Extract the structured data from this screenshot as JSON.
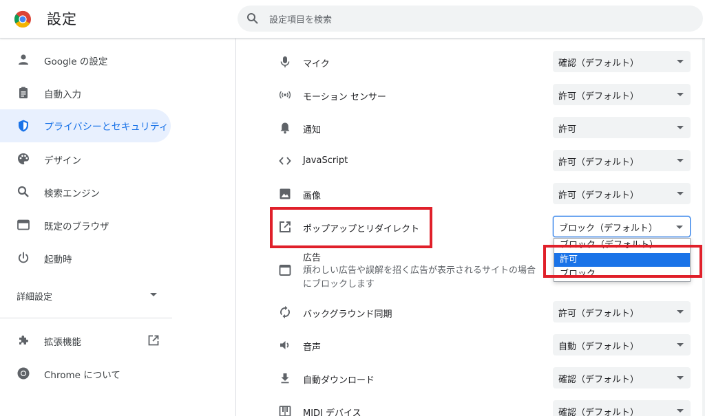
{
  "header": {
    "title": "設定",
    "search_placeholder": "設定項目を検索"
  },
  "sidebar": {
    "items": [
      {
        "label": "Google の設定",
        "icon": "person-icon"
      },
      {
        "label": "自動入力",
        "icon": "clipboard-icon"
      },
      {
        "label": "プライバシーとセキュリティ",
        "icon": "shield-icon",
        "active": true
      },
      {
        "label": "デザイン",
        "icon": "palette-icon"
      },
      {
        "label": "検索エンジン",
        "icon": "search-icon"
      },
      {
        "label": "既定のブラウザ",
        "icon": "browser-icon"
      },
      {
        "label": "起動時",
        "icon": "power-icon"
      }
    ],
    "advanced_label": "詳細設定",
    "extensions_label": "拡張機能",
    "about_label": "Chrome について"
  },
  "permissions": [
    {
      "label": "マイク",
      "value": "確認（デフォルト）",
      "icon": "mic-icon"
    },
    {
      "label": "モーション センサー",
      "value": "許可（デフォルト）",
      "icon": "motion-sensor-icon"
    },
    {
      "label": "通知",
      "value": "許可",
      "icon": "bell-icon"
    },
    {
      "label": "JavaScript",
      "value": "許可（デフォルト）",
      "icon": "code-icon"
    },
    {
      "label": "画像",
      "value": "許可（デフォルト）",
      "icon": "image-icon"
    },
    {
      "label": "ポップアップとリダイレクト",
      "value": "ブロック（デフォルト）",
      "icon": "open-in-new-icon"
    }
  ],
  "ads": {
    "title": "広告",
    "description": "煩わしい広告や誤解を招く広告が表示されるサイトの場合にブロックします"
  },
  "dropdown": {
    "options": [
      "ブロック（デフォルト）",
      "許可",
      "ブロック"
    ],
    "selected_index": 1
  },
  "permissions_after": [
    {
      "label": "バックグラウンド同期",
      "value": "許可（デフォルト）",
      "icon": "sync-icon"
    },
    {
      "label": "音声",
      "value": "自動（デフォルト）",
      "icon": "volume-icon"
    },
    {
      "label": "自動ダウンロード",
      "value": "確認（デフォルト）",
      "icon": "download-icon"
    },
    {
      "label": "MIDI デバイス",
      "value": "確認（デフォルト）",
      "icon": "piano-icon"
    }
  ],
  "colors": {
    "accent": "#1a73e8",
    "highlight": "#e0202a"
  }
}
